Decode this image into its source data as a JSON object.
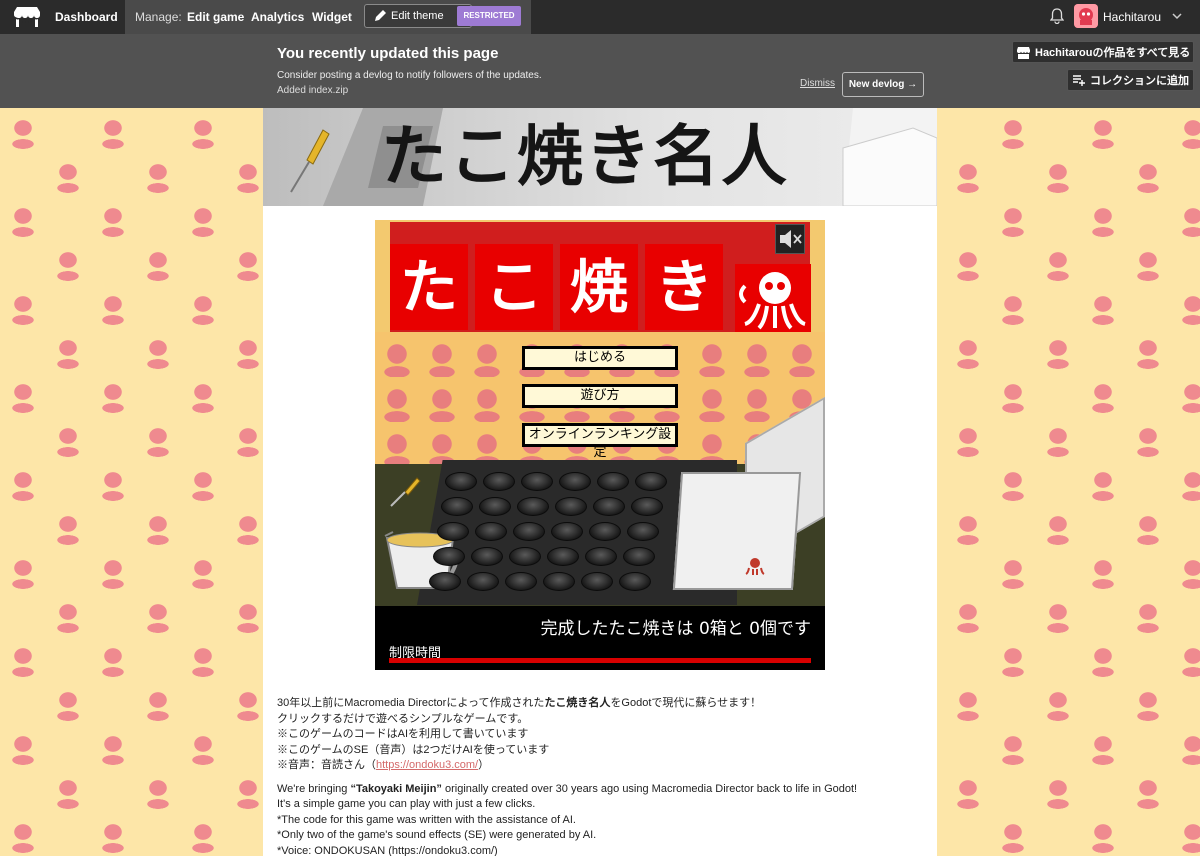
{
  "topbar": {
    "dashboard": "Dashboard",
    "manage_label": "Manage:",
    "edit_game": "Edit game",
    "analytics": "Analytics",
    "widget": "Widget",
    "edit_theme": "Edit theme",
    "restricted": "RESTRICTED",
    "username": "Hachitarou"
  },
  "notice": {
    "title": "You recently updated this page",
    "body": "Consider posting a devlog to notify followers of the updates.",
    "added": "Added index.zip",
    "dismiss": "Dismiss",
    "new_devlog": "New devlog →"
  },
  "side_buttons": {
    "view_all": "Hachitarouの作品をすべて見る",
    "add_collection": "コレクションに追加"
  },
  "banner": {
    "title": "たこ焼き名人"
  },
  "game": {
    "title_chars": [
      "た",
      "こ",
      "焼",
      "き"
    ],
    "start": "はじめる",
    "how_to": "遊び方",
    "ranking": "オンラインランキング設定",
    "count_text": "完成したたこ焼きは 0箱と 0個です",
    "time_label": "制限時間"
  },
  "description": {
    "jp_line1_pre": "30年以上前にMacromedia Directorによって作成された",
    "jp_line1_bold": "たこ焼き名人",
    "jp_line1_post": "をGodotで現代に蘇らせます！",
    "jp_line2": "クリックするだけで遊べるシンプルなゲームです。",
    "jp_line3": "※このゲームのコードはAIを利用して書いています",
    "jp_line4": "※このゲームのSE（音声）は2つだけAIを使っています",
    "jp_line5_pre": "※音声：音読さん（",
    "jp_line5_link": "https://ondoku3.com/",
    "jp_line5_post": "）",
    "en_line1_pre": "We're bringing ",
    "en_line1_bold": "“Takoyaki Meijin”",
    "en_line1_post": " originally created over 30 years ago using Macromedia Director back to life in Godot!",
    "en_line2": "It's a simple game you can play with just a few clicks.",
    "en_line3": "*The code for this game was written with the assistance of AI.",
    "en_line4": "*Only two of the game's sound effects (SE) were generated by AI.",
    "en_line5": "*Voice: ONDOKUSAN (https://ondoku3.com/)"
  },
  "colors": {
    "topbar": "#2b2b2b",
    "notice": "#525252",
    "restricted_badge": "#9e7bd4",
    "wallpaper": "#fde6a8",
    "octopus": "#ef8a8f",
    "game_red": "#e80000"
  }
}
